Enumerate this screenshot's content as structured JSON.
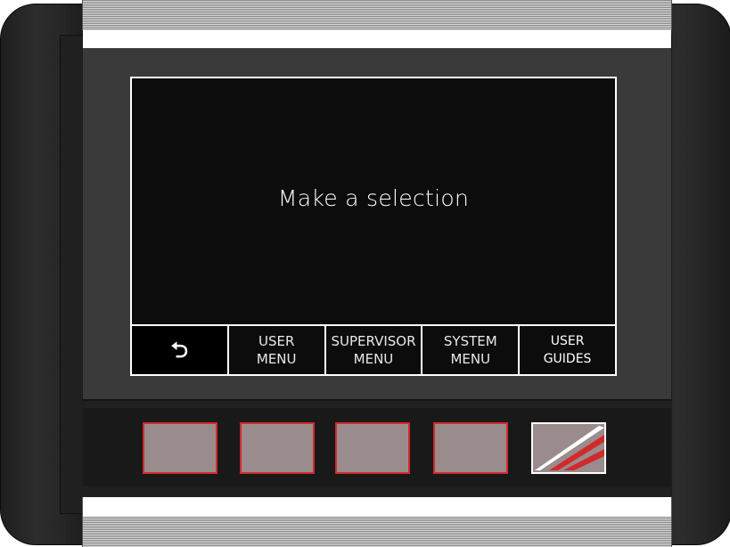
{
  "screen": {
    "prompt": "Make a selection"
  },
  "softkeys": [
    {
      "label": "",
      "icon": "back-arrow-icon"
    },
    {
      "label": "USER\nMENU"
    },
    {
      "label": "SUPERVISOR\nMENU"
    },
    {
      "label": "SYSTEM\nMENU"
    },
    {
      "label": "USER\nGUIDES"
    }
  ],
  "colors": {
    "screen_bg": "#0c0c0c",
    "key_fill": "#9a8c8c",
    "key_border": "#d12a2a",
    "logo_red": "#d12a2a"
  }
}
